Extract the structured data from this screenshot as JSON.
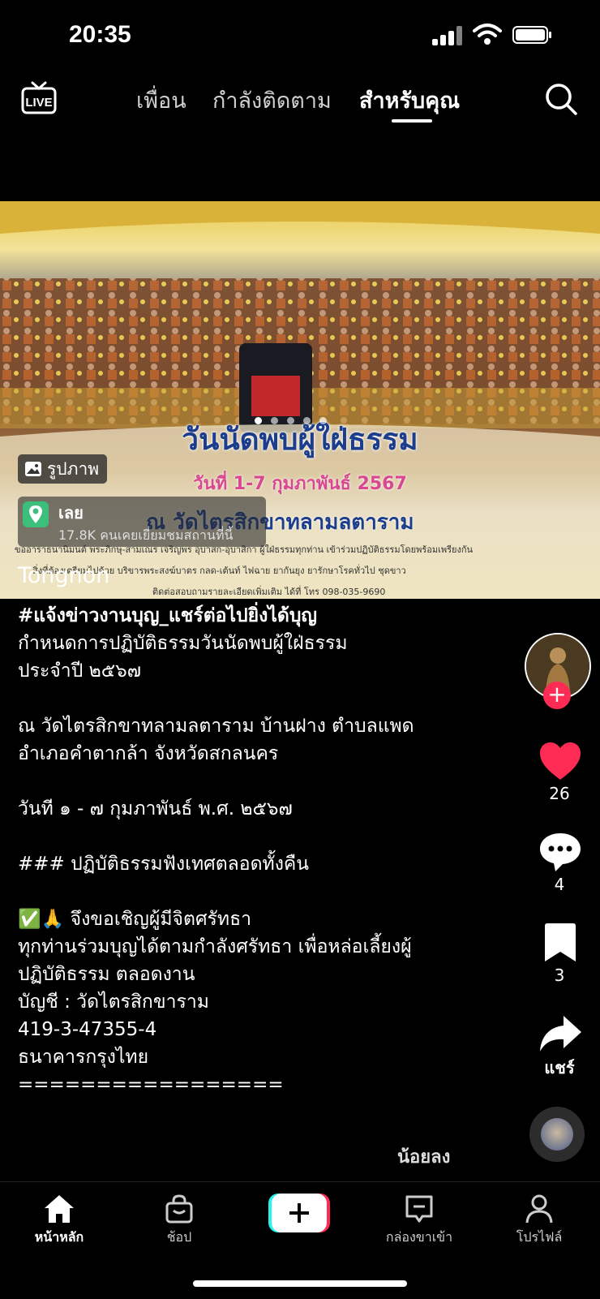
{
  "status_bar": {
    "time": "20:35"
  },
  "top_nav": {
    "live_label": "LIVE",
    "tabs": [
      {
        "label": "เพื่อน"
      },
      {
        "label": "กำลังติดตาม"
      },
      {
        "label": "สำหรับคุณ",
        "active": true
      }
    ]
  },
  "photo": {
    "badge_label": "รูปภาพ",
    "banner_title": "วันนัดพบผู้ใฝ่ธรรม",
    "banner_date": "วันที่ 1-7 กุมภาพันธ์ 2567",
    "banner_temple": "ณ วัดไตรสิกขาทลามลตาราม",
    "banner_line1": "ขออาราธนานิมนต์ พระภิกษุ-สามเณร เจริญพร อุบาสก-อุบาสิกา ผู้ใฝ่ธรรมทุกท่าน เข้าร่วมปฏิบัติธรรมโดยพร้อมเพรียงกัน",
    "banner_line2": "สิ่งที่ต้องเตรียมไปด้วย บริขารพระสงฆ์บาตร กลด-เต้นท์ ไฟฉาย ยากันยุง ยารักษาโรคทั่วไป ชุดขาว",
    "banner_line3": "ติดต่อสอบถามรายละเอียดเพิ่มเติม ได้ที่ โทร 098-035-9690",
    "page_count": 5,
    "active_page": 1
  },
  "location": {
    "name": "เลย",
    "visitors": "17.8K คนเคยเยี่ยมชมสถานที่นี้"
  },
  "author": "Tongnon",
  "caption": {
    "hashtag": "#แจ้งข่าวงานบุญ_แชร์ต่อไปยิ่งได้บุญ",
    "line1": "กำหนดการปฏิบัติธรรมวันนัดพบผู้ใฝ่ธรรม",
    "line2": "ประจำปี ๒๕๖๗",
    "line3": "ณ วัดไตรสิกขาทลามลตาราม บ้านฝาง ตำบลแพด",
    "line4": "อำเภอคำตากล้า จังหวัดสกลนคร",
    "line5": "วันที ๑ - ๗ กุมภาพันธ์ พ.ศ. ๒๕๖๗",
    "line6": "### ปฏิบัติธรรมฟังเทศตลอดทั้งคืน",
    "line7": "✅🙏 จึงขอเชิญผู้มีจิตศรัทธา",
    "line8": "ทุกท่านร่วมบุญได้ตามกำลังศรัทธา เพื่อหล่อเลี้ยงผู้",
    "line9": "ปฏิบัติธรรม ตลอดงาน",
    "line10": "บัญชี : วัดไตรสิกขาราม",
    "line11": "419-3-47355-4",
    "line12": "ธนาคารกรุงไทย",
    "line13": "=================",
    "show_less": "น้อยลง"
  },
  "rail": {
    "likes": "26",
    "comments": "4",
    "saves": "3",
    "share_label": "แชร์"
  },
  "bottom_nav": {
    "home": "หน้าหลัก",
    "shop": "ช้อป",
    "inbox": "กล่องขาเข้า",
    "profile": "โปรไฟล์"
  },
  "colors": {
    "like": "#fe2c55",
    "accent_cyan": "#25f4ee",
    "accent_red": "#fe2c55"
  }
}
